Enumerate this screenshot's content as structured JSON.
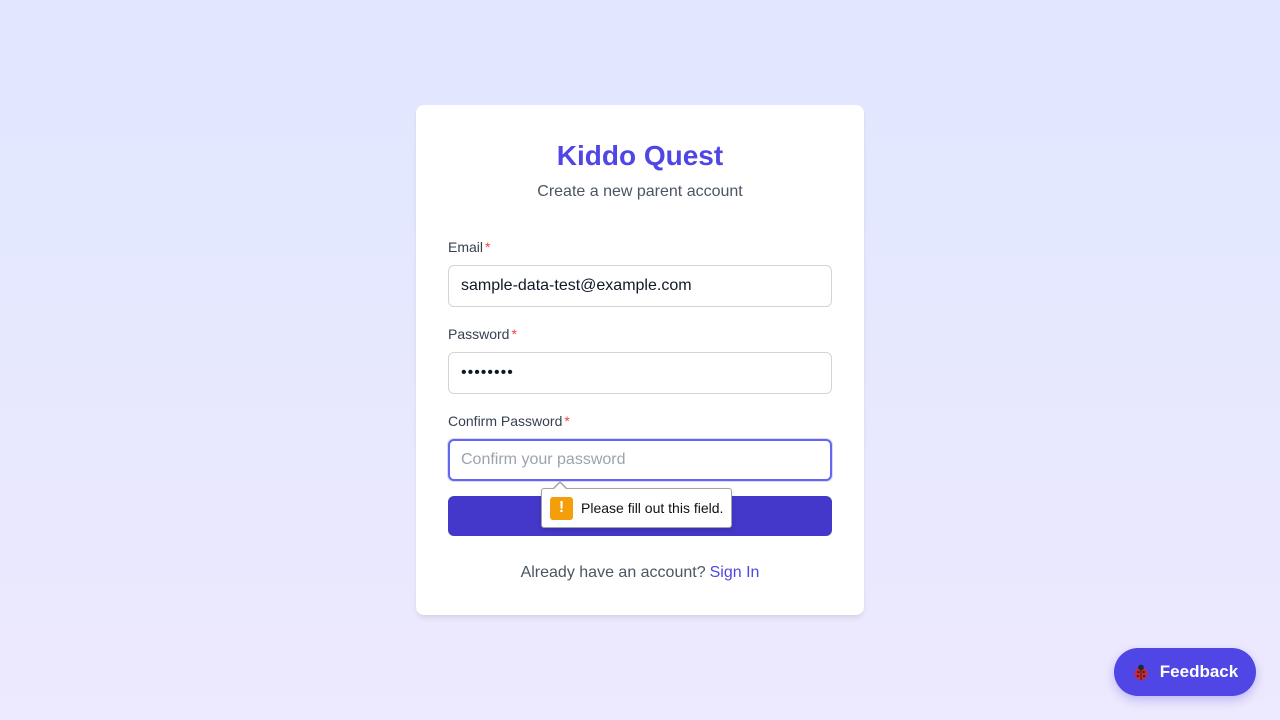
{
  "app": {
    "title": "Kiddo Quest",
    "subtitle": "Create a new parent account"
  },
  "form": {
    "email": {
      "label": "Email",
      "required_mark": "*",
      "value": "sample-data-test@example.com"
    },
    "password": {
      "label": "Password",
      "required_mark": "*",
      "value": "••••••••"
    },
    "confirm": {
      "label": "Confirm Password",
      "required_mark": "*",
      "placeholder": "Confirm your password",
      "value": ""
    },
    "submit_label": ""
  },
  "validation": {
    "message": "Please fill out this field.",
    "icon": "warning-icon",
    "icon_glyph": "!"
  },
  "footer": {
    "prompt": "Already have an account?",
    "link": "Sign In"
  },
  "feedback_button": {
    "label": "Feedback",
    "icon": "ladybug-icon"
  },
  "colors": {
    "accent": "#4f46e5",
    "button": "#4338ca",
    "warning": "#f59e0b",
    "required": "#ef4444"
  }
}
